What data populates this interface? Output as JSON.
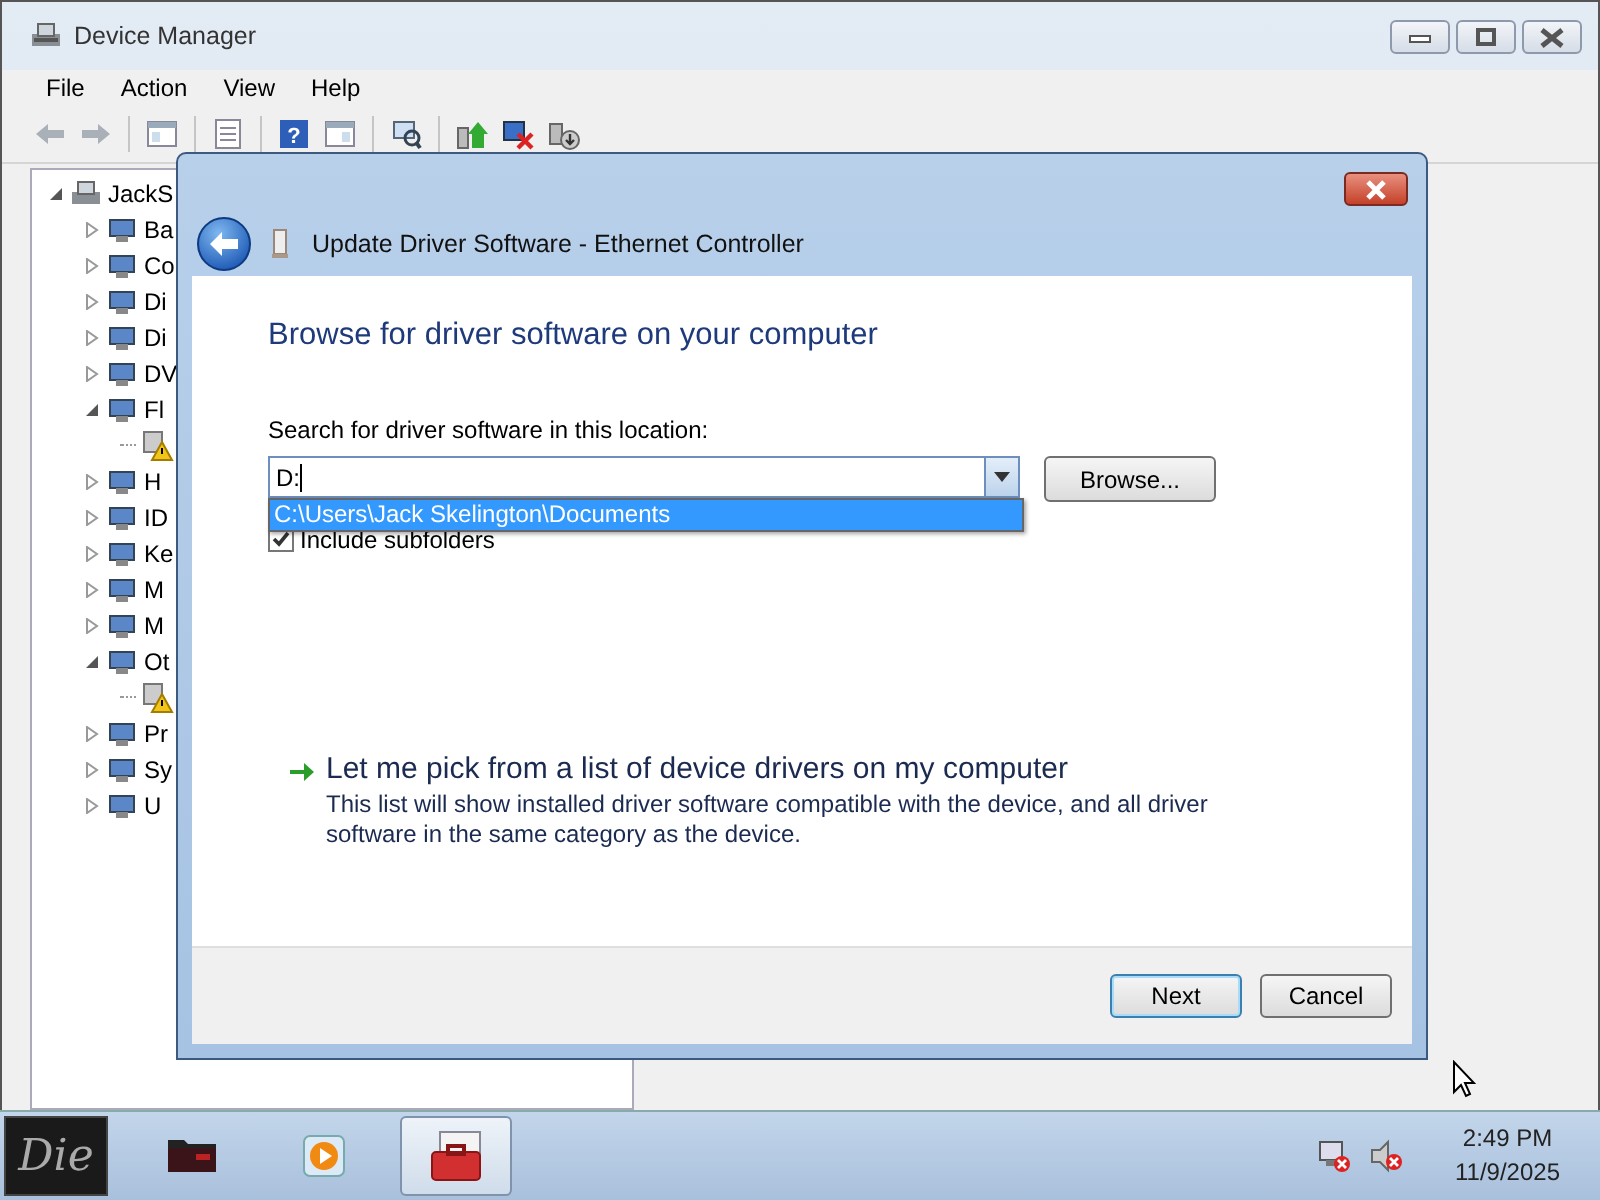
{
  "window": {
    "title": "Device Manager"
  },
  "menu": [
    "File",
    "Action",
    "View",
    "Help"
  ],
  "toolbar": {
    "help_glyph": "?"
  },
  "tree": {
    "label": "JackS",
    "expanded": true,
    "warning": false,
    "children": [
      {
        "label": "Ba",
        "expanded": false,
        "warning": false
      },
      {
        "label": "Co",
        "expanded": false,
        "warning": false
      },
      {
        "label": "Di",
        "expanded": false,
        "warning": false
      },
      {
        "label": "Di",
        "expanded": false,
        "warning": false
      },
      {
        "label": "DV",
        "expanded": false,
        "warning": false
      },
      {
        "label": "Fl",
        "expanded": true,
        "warning": false,
        "children": [
          {
            "warning": true
          }
        ]
      },
      {
        "label": "H",
        "expanded": false,
        "warning": false
      },
      {
        "label": "ID",
        "expanded": false,
        "warning": false
      },
      {
        "label": "Ke",
        "expanded": false,
        "warning": false
      },
      {
        "label": "M",
        "expanded": false,
        "warning": false
      },
      {
        "label": "M",
        "expanded": false,
        "warning": false
      },
      {
        "label": "Ot",
        "expanded": true,
        "warning": false,
        "children": [
          {
            "warning": true
          }
        ]
      },
      {
        "label": "Pr",
        "expanded": false,
        "warning": false
      },
      {
        "label": "Sy",
        "expanded": false,
        "warning": false
      },
      {
        "label": "U",
        "expanded": false,
        "warning": false
      }
    ]
  },
  "dialog": {
    "title": "Update Driver Software - Ethernet Controller",
    "heading": "Browse for driver software on your computer",
    "location_label": "Search for driver software in this location:",
    "location": {
      "value": "D:",
      "suggestions": [
        {
          "text": "C:\\Users\\Jack Skelington\\Documents",
          "selected": true
        }
      ]
    },
    "browse_button": "Browse...",
    "include_subfolders": {
      "label": "Include subfolders",
      "checked": true
    },
    "pick_link": {
      "title": "Let me pick from a list of device drivers on my computer",
      "description": "This list will show installed driver software compatible with the device, and all driver software in the same category as the device."
    },
    "buttons": [
      {
        "label": "Next",
        "default": true
      },
      {
        "label": "Cancel",
        "default": false
      }
    ]
  },
  "taskbar": {
    "start_label": "Die",
    "apps": [
      {
        "kind": "folder",
        "active": false
      },
      {
        "kind": "media",
        "active": false
      },
      {
        "kind": "toolbox",
        "active": true
      }
    ],
    "time": "2:49 PM",
    "date": "11/9/2025"
  }
}
